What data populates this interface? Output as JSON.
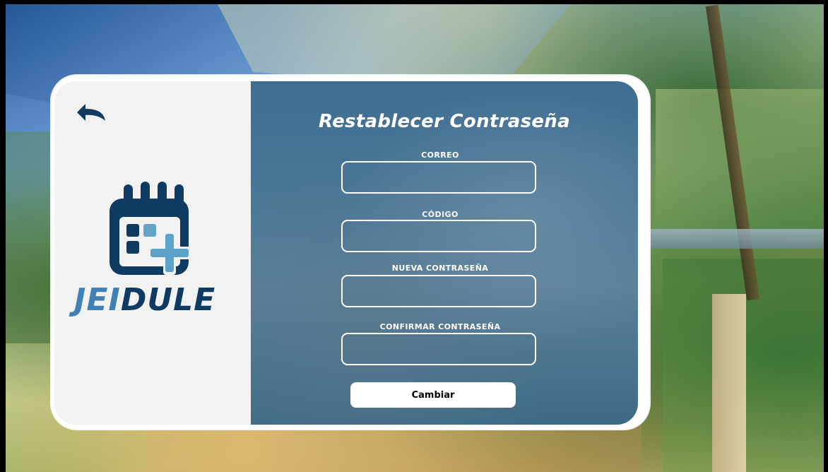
{
  "app": {
    "brand_part1": "JEI",
    "brand_part2": "DULE"
  },
  "form": {
    "title": "Restablecer Contraseña",
    "fields": [
      {
        "label": "CORREO",
        "value": ""
      },
      {
        "label": "CÓDIGO",
        "value": ""
      },
      {
        "label": "NUEVA CONTRASEÑA",
        "value": ""
      },
      {
        "label": "CONFIRMAR CONTRASEÑA",
        "value": ""
      }
    ],
    "submit_label": "Cambiar"
  },
  "icons": {
    "back": "back-arrow-icon",
    "logo": "calendar-plus-icon"
  },
  "colors": {
    "brand_light": "#3f81b5",
    "brand_dark": "#0f3b62",
    "panel_blue": "#4d7998",
    "card_white": "#ffffff"
  }
}
